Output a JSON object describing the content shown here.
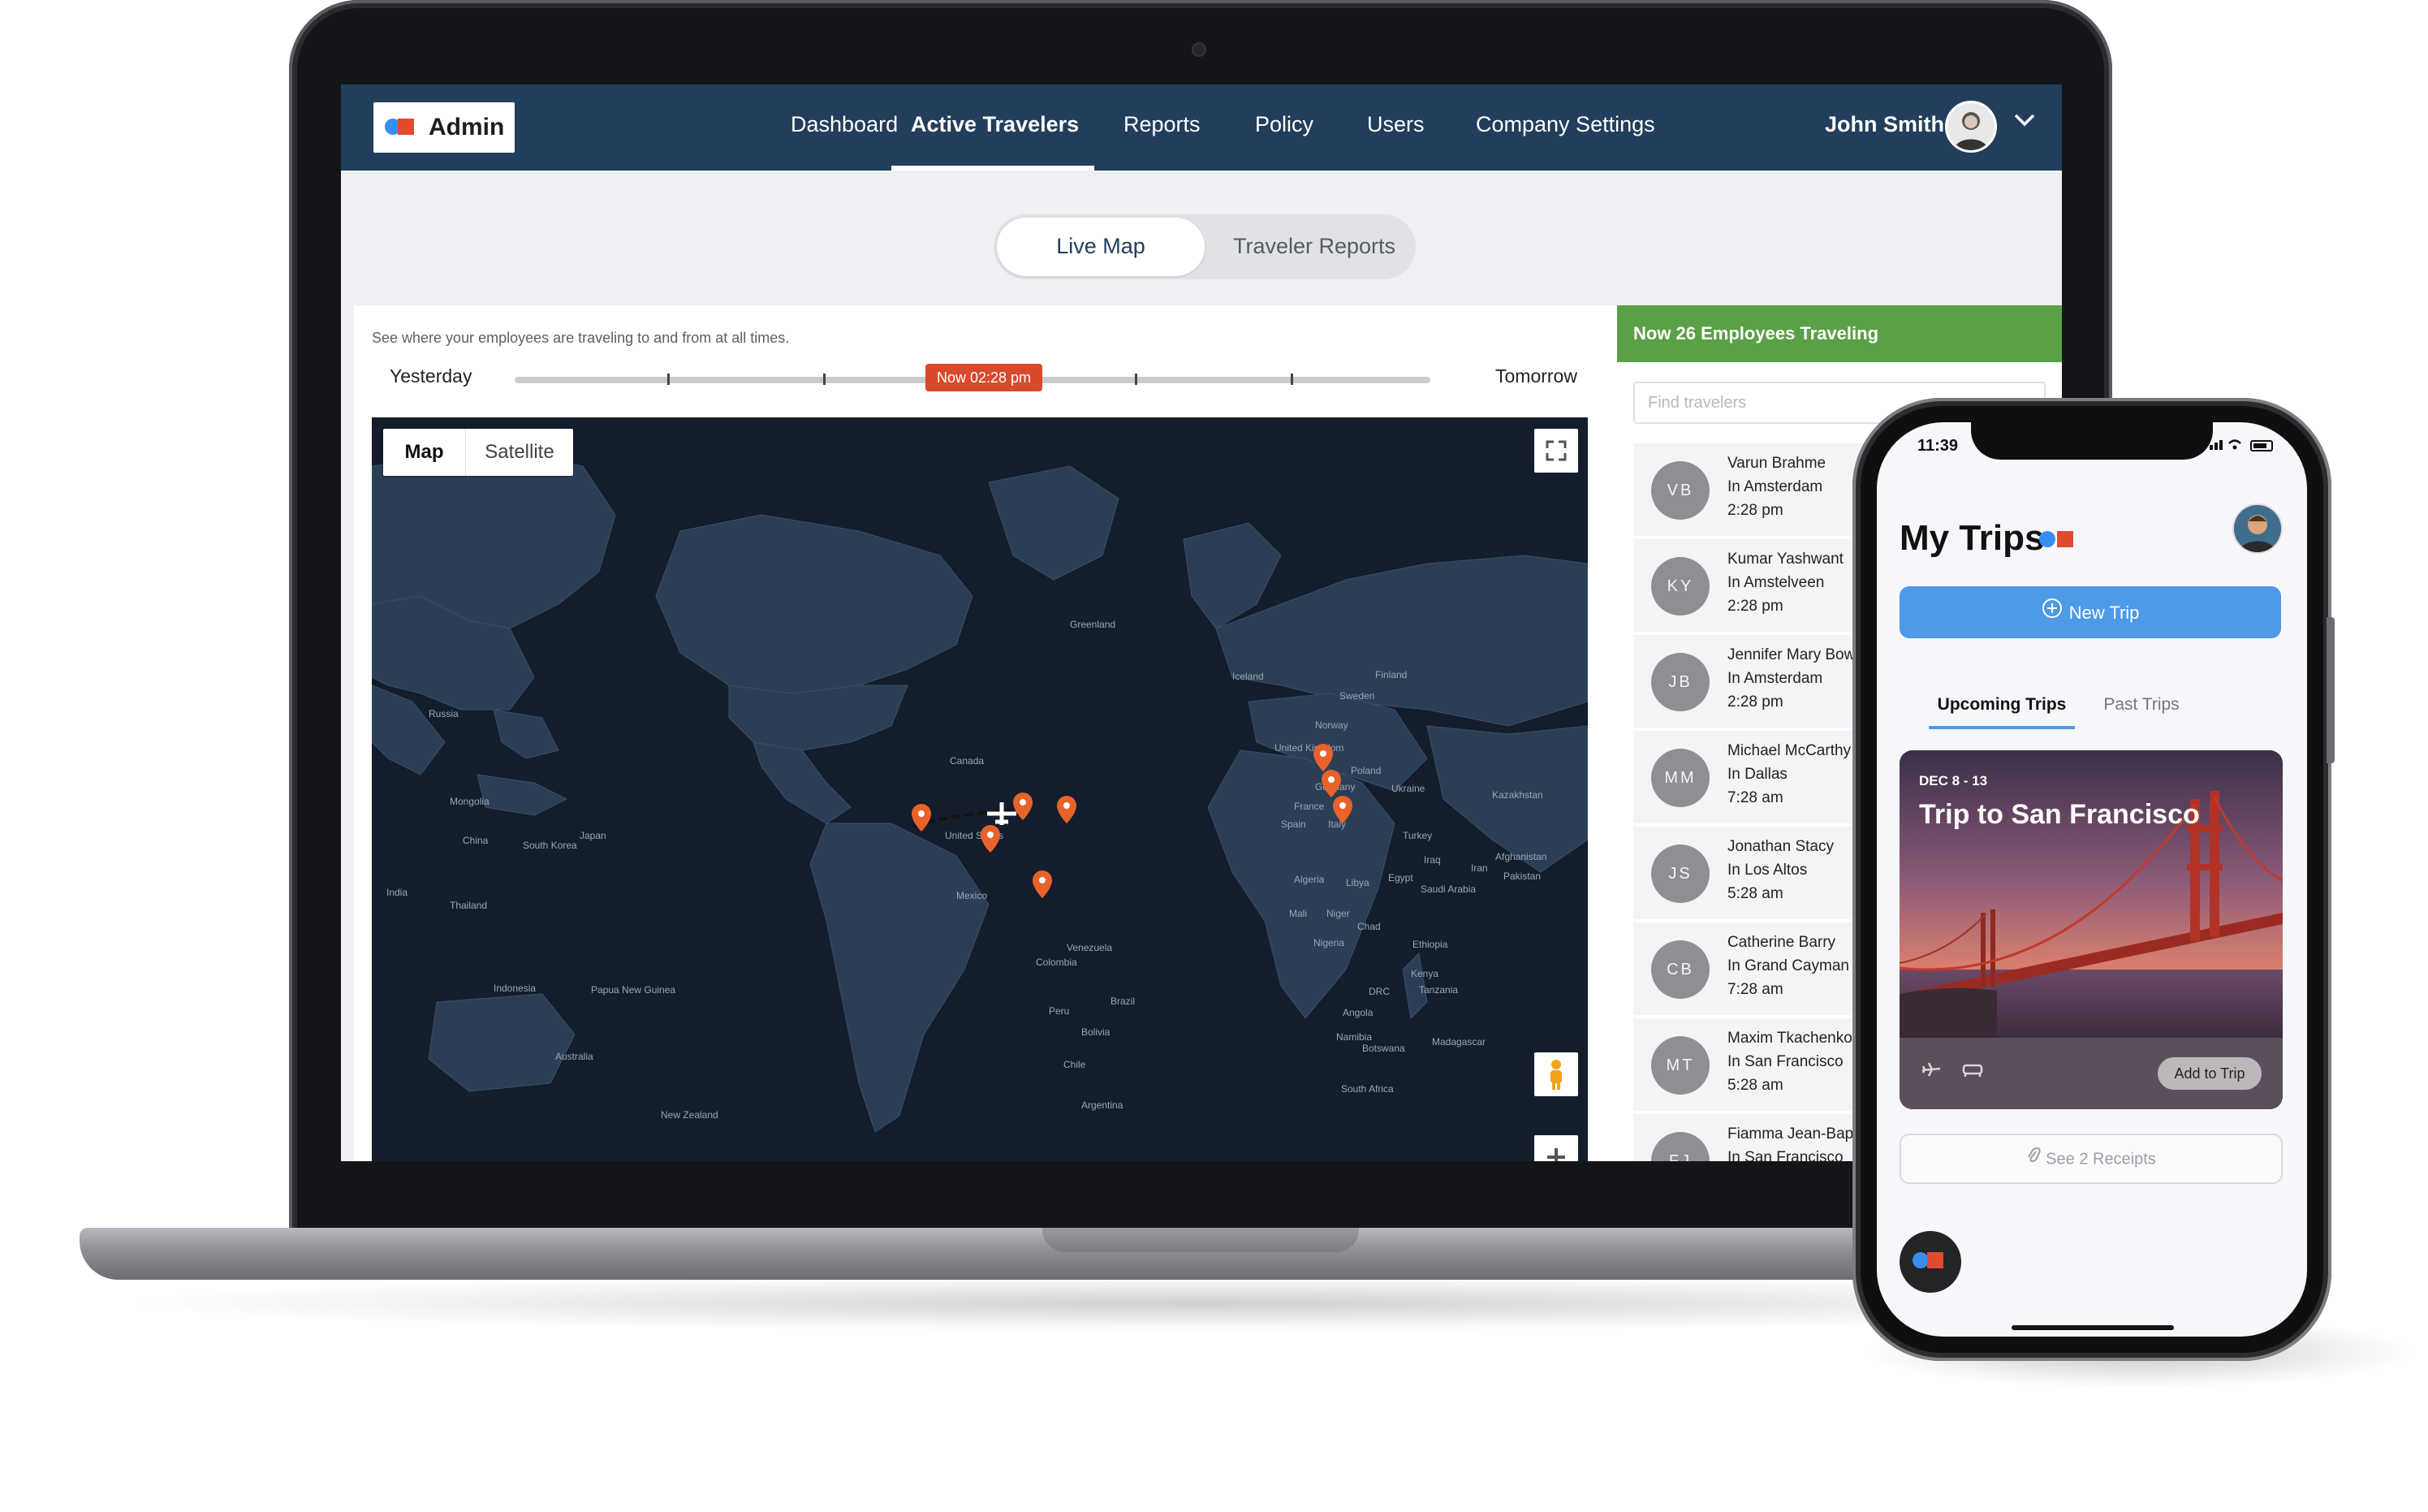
{
  "admin": {
    "logo_text": "Admin",
    "nav": [
      "Dashboard",
      "Active Travelers",
      "Reports",
      "Policy",
      "Users",
      "Company Settings"
    ],
    "active_nav": "Active Travelers",
    "user_name": "John Smith",
    "toggle": {
      "live_map": "Live Map",
      "traveler_reports": "Traveler Reports",
      "selected": "Live Map"
    }
  },
  "map_panel": {
    "description": "See where your employees are traveling to and from at all times.",
    "timeline": {
      "start_label": "Yesterday",
      "end_label": "Tomorrow",
      "now_label": "Now 02:28 pm"
    },
    "map_type": {
      "map": "Map",
      "satellite": "Satellite",
      "selected": "Map"
    },
    "labels": [
      "Greenland",
      "Iceland",
      "Finland",
      "Sweden",
      "Norway",
      "United Kingdom",
      "Poland",
      "Germany",
      "Ukraine",
      "France",
      "Spain",
      "Italy",
      "Turkey",
      "Kazakhstan",
      "Afghanistan",
      "Pakistan",
      "Iraq",
      "Iran",
      "Saudi Arabia",
      "Egypt",
      "Libya",
      "Algeria",
      "Mali",
      "Niger",
      "Chad",
      "Nigeria",
      "Ethiopia",
      "Kenya",
      "DRC",
      "Tanzania",
      "Angola",
      "Namibia",
      "Botswana",
      "Madagascar",
      "South Africa",
      "Russia",
      "Mongolia",
      "China",
      "South Korea",
      "Japan",
      "India",
      "Thailand",
      "Indonesia",
      "Papua New Guinea",
      "Australia",
      "New Zealand",
      "Canada",
      "United States",
      "Mexico",
      "Venezuela",
      "Colombia",
      "Brazil",
      "Peru",
      "Bolivia",
      "Chile",
      "Argentina"
    ],
    "pin_color": "#e8622a"
  },
  "travelers": {
    "header": "Now 26 Employees Traveling",
    "search_placeholder": "Find travelers",
    "list": [
      {
        "initials": "VB",
        "name": "Varun Brahme",
        "location": "In Amsterdam",
        "time": "2:28 pm"
      },
      {
        "initials": "KY",
        "name": "Kumar Yashwant",
        "location": "In Amstelveen",
        "time": "2:28 pm"
      },
      {
        "initials": "JB",
        "name": "Jennifer Mary Bowe",
        "location": "In Amsterdam",
        "time": "2:28 pm"
      },
      {
        "initials": "MM",
        "name": "Michael McCarthy",
        "location": "In Dallas",
        "time": "7:28 am"
      },
      {
        "initials": "JS",
        "name": "Jonathan Stacy",
        "location": "In Los Altos",
        "time": "5:28 am"
      },
      {
        "initials": "CB",
        "name": "Catherine Barry",
        "location": "In Grand Cayman",
        "time": "7:28 am"
      },
      {
        "initials": "MT",
        "name": "Maxim Tkachenko",
        "location": "In San Francisco",
        "time": "5:28 am"
      },
      {
        "initials": "FJ",
        "name": "Fiamma Jean-Baptis",
        "location": "In San Francisco",
        "time": ""
      }
    ]
  },
  "phone": {
    "time": "11:39",
    "title": "My Trips",
    "new_trip": "New Trip",
    "tabs": {
      "upcoming": "Upcoming Trips",
      "past": "Past Trips",
      "selected": "Upcoming Trips"
    },
    "trip": {
      "date": "DEC 8 - 13",
      "title": "Trip to San Francisco",
      "add_button": "Add to Trip"
    },
    "receipts": "See 2 Receipts"
  },
  "colors": {
    "topbar": "#233e5c",
    "traveling_header": "#5aa046",
    "accent_blue": "#4e9ae8",
    "brand_red": "#e34a2f",
    "brand_blue": "#3a8df0",
    "now_marker": "#d94a2b"
  }
}
